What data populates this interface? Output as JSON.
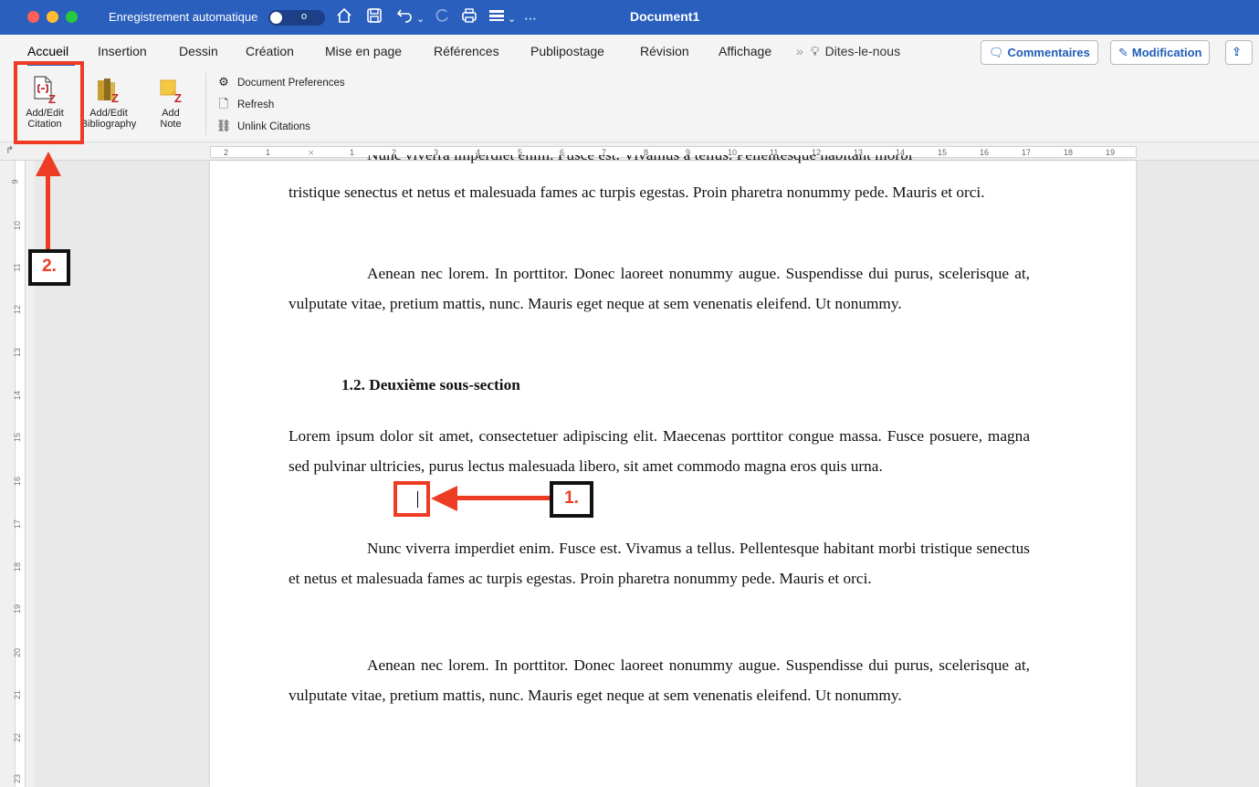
{
  "titlebar": {
    "autosave_label": "Enregistrement automatique",
    "autosave_state": "o",
    "document_title": "Document1",
    "more": "⋯"
  },
  "menu": {
    "items": [
      "Accueil",
      "Insertion",
      "Dessin",
      "Création",
      "Mise en page",
      "Références",
      "Publipostage",
      "Révision",
      "Affichage"
    ],
    "tell_me": "Dites-le-nous",
    "comments_button": "Commentaires",
    "editing_button": "Modification"
  },
  "ribbon": {
    "add_edit_citation": [
      "Add/Edit",
      "Citation"
    ],
    "add_edit_bibliography": [
      "Add/Edit",
      "Bibliography"
    ],
    "add_note": [
      "Add",
      "Note"
    ],
    "document_preferences": "Document Preferences",
    "refresh": "Refresh",
    "unlink_citations": "Unlink Citations"
  },
  "ruler": {
    "h_numbers": [
      "2",
      "1",
      "1",
      "2",
      "3",
      "4",
      "5",
      "6",
      "7",
      "8",
      "9",
      "10",
      "11",
      "12",
      "13",
      "14",
      "15",
      "16",
      "17",
      "18",
      "19"
    ],
    "v_numbers": [
      "9",
      "10",
      "11",
      "12",
      "13",
      "14",
      "15",
      "16",
      "17",
      "18",
      "19",
      "20",
      "21",
      "22",
      "23"
    ]
  },
  "document": {
    "cutoff_line": "Nunc viverra imperdiet enim. Fusce est. Vivamus a tellus. Pellentesque habitant morbi",
    "p1": "tristique senectus et netus et malesuada fames ac turpis egestas. Proin pharetra nonummy pede. Mauris et orci.",
    "p2": "Aenean nec lorem. In porttitor. Donec laoreet nonummy augue. Suspendisse dui purus, scelerisque at, vulputate vitae, pretium mattis, nunc. Mauris eget neque at sem venenatis eleifend. Ut nonummy.",
    "heading": "1.2. Deuxième sous-section",
    "p3_before_caret": "Lorem ipsum dolor sit amet, consectetuer adipiscing elit. Maecenas porttitor congue massa. Fusce posuere, magna sed pulvinar ultricies, purus lectus malesuada libero, sit amet commodo magna eros quis urna.",
    "p4": "Nunc viverra imperdiet enim. Fusce est. Vivamus a tellus. Pellentesque habitant morbi tristique senectus et netus et malesuada fames ac turpis egestas. Proin pharetra nonummy pede. Mauris et orci.",
    "p5": "Aenean nec lorem. In porttitor. Donec laoreet nonummy augue. Suspendisse dui purus, scelerisque at, vulputate vitae, pretium mattis, nunc. Mauris eget neque at sem venenatis eleifend. Ut nonummy."
  },
  "annotations": {
    "step1": "1.",
    "step2": "2.",
    "color": "#ee3c24"
  },
  "colors": {
    "titlebar": "#2b5fbe",
    "accent": "#1f5cb8",
    "zotero_red": "#c0282d"
  }
}
